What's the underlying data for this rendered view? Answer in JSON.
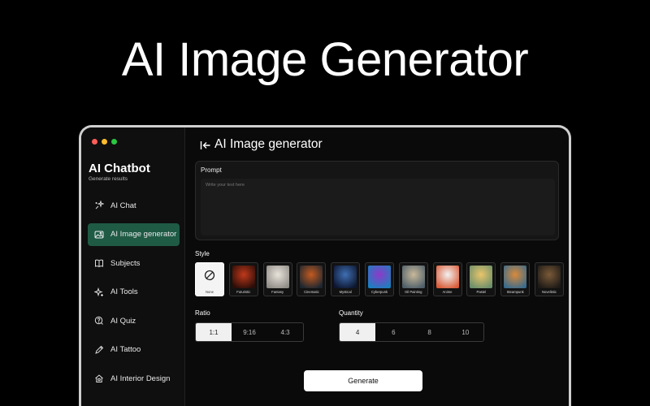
{
  "hero": {
    "title": "AI Image Generator"
  },
  "window": {
    "dot_colors": [
      "#ff5f57",
      "#febc2e",
      "#28c840"
    ]
  },
  "sidebar": {
    "brand": "AI Chatbot",
    "subtitle": "Generate results",
    "items": [
      {
        "label": "AI Chat",
        "icon": "sparkle-chat-icon",
        "active": false
      },
      {
        "label": "AI Image generator",
        "icon": "image-icon",
        "active": true
      },
      {
        "label": "Subjects",
        "icon": "book-icon",
        "active": false
      },
      {
        "label": "AI Tools",
        "icon": "sparkle-icon",
        "active": false
      },
      {
        "label": "AI Quiz",
        "icon": "quiz-icon",
        "active": false
      },
      {
        "label": "AI Tattoo",
        "icon": "pen-icon",
        "active": false
      },
      {
        "label": "AI Interior Design",
        "icon": "home-icon",
        "active": false
      }
    ],
    "accent": "#1f5a45"
  },
  "main": {
    "title": "AI Image generator",
    "prompt": {
      "label": "Prompt",
      "placeholder": "Write your text here",
      "value": ""
    },
    "style": {
      "label": "Style",
      "options": [
        {
          "name": "None",
          "selected": true,
          "colors": [
            "#f4f4f4",
            "#f4f4f4"
          ]
        },
        {
          "name": "Futuristic",
          "selected": false,
          "colors": [
            "#c0391b",
            "#2a0d08"
          ]
        },
        {
          "name": "Fantasy",
          "selected": false,
          "colors": [
            "#e8e3da",
            "#8f8b86"
          ]
        },
        {
          "name": "Cinematic",
          "selected": false,
          "colors": [
            "#c45a1f",
            "#1c2630"
          ]
        },
        {
          "name": "Mystical",
          "selected": false,
          "colors": [
            "#3f6fb3",
            "#0d1630"
          ]
        },
        {
          "name": "Cyberpunk",
          "selected": false,
          "colors": [
            "#8d3ac9",
            "#1c7fbf"
          ]
        },
        {
          "name": "Oil Painting",
          "selected": false,
          "colors": [
            "#c9b99a",
            "#4e5f6a"
          ]
        },
        {
          "name": "Anime",
          "selected": false,
          "colors": [
            "#f2f2f2",
            "#d95b36"
          ]
        },
        {
          "name": "Pastel",
          "selected": false,
          "colors": [
            "#e9c56b",
            "#6c8f6b"
          ]
        },
        {
          "name": "Steampunk",
          "selected": false,
          "colors": [
            "#d98a3b",
            "#3a6b8c"
          ]
        },
        {
          "name": "Novelistic",
          "selected": false,
          "colors": [
            "#7a5a38",
            "#1e1a16"
          ]
        }
      ]
    },
    "ratio": {
      "label": "Ratio",
      "options": [
        "1:1",
        "9:16",
        "4:3"
      ],
      "selected": 0
    },
    "quantity": {
      "label": "Quantity",
      "options": [
        "4",
        "6",
        "8",
        "10"
      ],
      "selected": 0
    },
    "generate_label": "Generate"
  }
}
